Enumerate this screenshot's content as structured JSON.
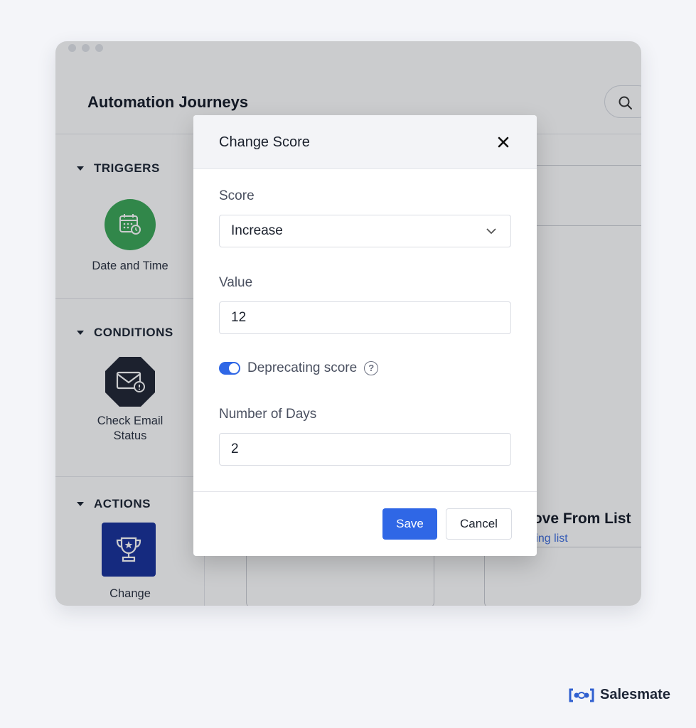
{
  "window": {
    "title": "Automation Journeys"
  },
  "sidebar": {
    "sections": [
      {
        "title": "TRIGGERS",
        "item_label": "Date and Time",
        "icon": "calendar-clock-icon",
        "icon_color": "#3aa757"
      },
      {
        "title": "CONDITIONS",
        "item_label": "Check Email\nStatus",
        "icon": "email-status-icon",
        "icon_color": "#1f2533"
      },
      {
        "title": "ACTIONS",
        "item_label": "Change",
        "icon": "trophy-icon",
        "icon_color": "#17309a"
      }
    ]
  },
  "background_node": {
    "title": "nove From List",
    "subtitle": "eting list"
  },
  "modal": {
    "title": "Change Score",
    "score_label": "Score",
    "score_value": "Increase",
    "value_label": "Value",
    "value_value": "12",
    "toggle_label": "Deprecating score",
    "toggle_on": true,
    "days_label": "Number of Days",
    "days_value": "2",
    "save_label": "Save",
    "cancel_label": "Cancel"
  },
  "brand": {
    "name": "Salesmate"
  },
  "colors": {
    "accent": "#2f67e6",
    "link": "#3f6fe0",
    "connector_dot": "#e7b40c"
  }
}
